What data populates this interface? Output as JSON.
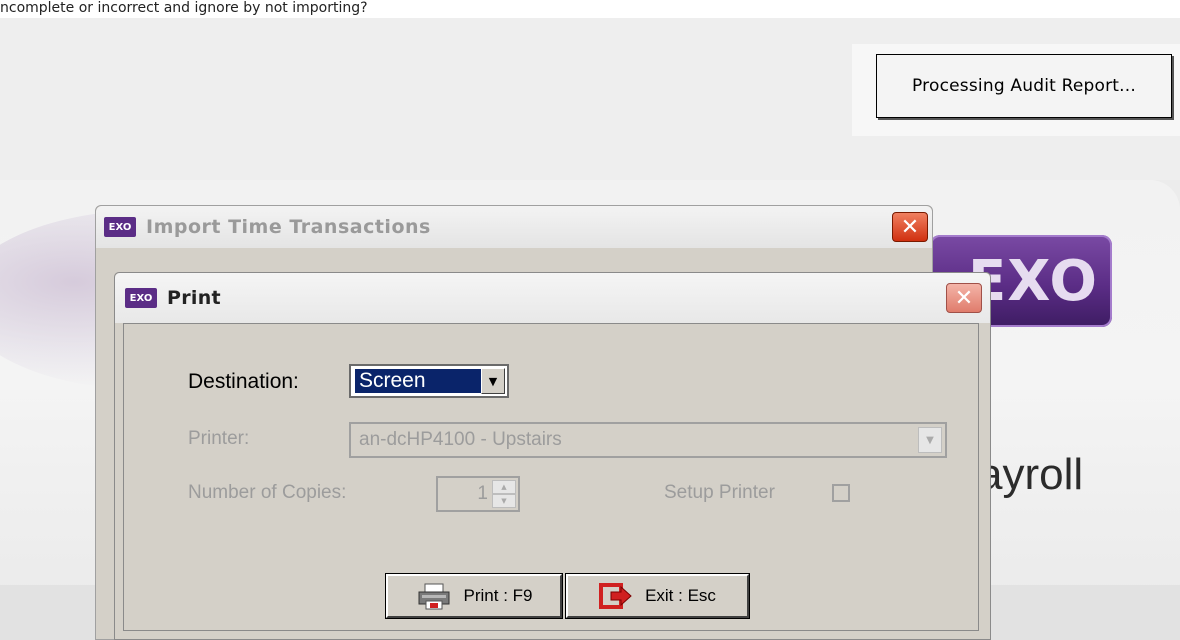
{
  "top_caption": "ncomplete or incorrect and ignore by not importing?",
  "status_popup": {
    "text": "Processing Audit Report..."
  },
  "background_app": {
    "logo_text": "EXO",
    "title_fragment": "ayroll"
  },
  "import_window": {
    "title": "Import Time Transactions",
    "icon_text": "EXO"
  },
  "print_dialog": {
    "title": "Print",
    "icon_text": "EXO",
    "destination": {
      "label": "Destination:",
      "value": "Screen"
    },
    "printer": {
      "label": "Printer:",
      "value": "an-dcHP4100 - Upstairs"
    },
    "copies": {
      "label": "Number of Copies:",
      "value": "1"
    },
    "setup_printer": {
      "label": "Setup Printer",
      "checked": false
    },
    "buttons": {
      "print_label": "Print : F9",
      "exit_label": "Exit : Esc"
    }
  },
  "colors": {
    "selection": "#0a246a",
    "exo_purple": "#5b2d86",
    "dialog_face": "#d4d0c8",
    "close_red": "#d03010"
  }
}
